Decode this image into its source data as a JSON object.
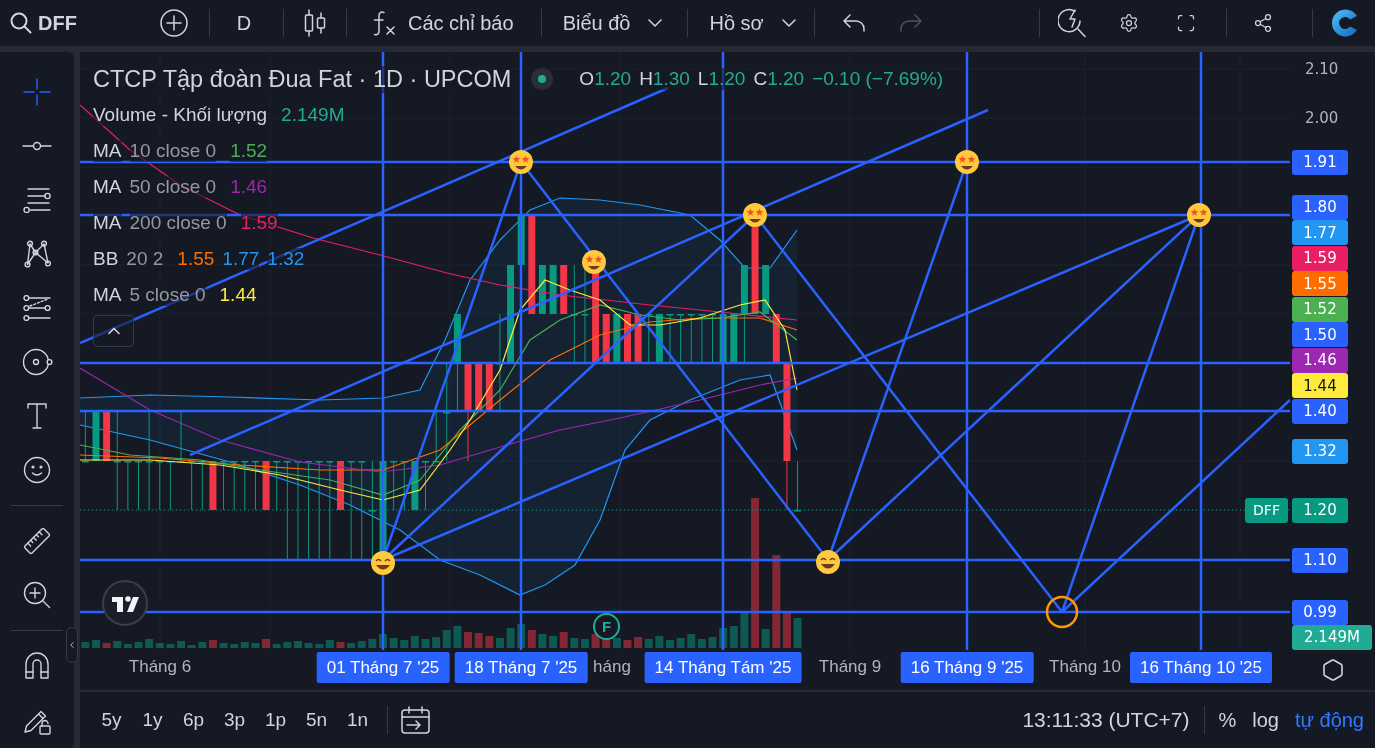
{
  "toolbar": {
    "symbol": "DFF",
    "interval": "D",
    "indicators": "Các chỉ báo",
    "menus": [
      {
        "label": "Biểu đồ"
      },
      {
        "label": "Hồ sơ"
      }
    ],
    "undo": {
      "disabled": false
    },
    "redo": {
      "disabled": true
    }
  },
  "sidebar": {
    "tools": [
      {
        "selected": true
      },
      {
        "selected": false
      },
      {
        "selected": false
      },
      {
        "selected": false
      },
      {
        "selected": false
      },
      {
        "selected": false
      },
      {
        "selected": false
      },
      {
        "selected": false
      },
      {
        "selected": false
      },
      {
        "selected": false
      },
      {
        "selected": false
      },
      {
        "selected": false
      }
    ]
  },
  "legend": {
    "title": "CTCP Tập đoàn Đua Fat · 1D · UPCOM",
    "ohlc": [
      {
        "label": "O",
        "value": "1.20"
      },
      {
        "label": "H",
        "value": "1.30"
      },
      {
        "label": "L",
        "value": "1.20"
      },
      {
        "label": "C",
        "value": "1.20"
      }
    ],
    "change": "−0.10 (−7.69%)",
    "indicators": [
      {
        "name": "Volume - Khối lượng",
        "values": [
          {
            "text": "2.149M",
            "color": "#22ab94"
          }
        ]
      },
      {
        "name": "MA",
        "params": "10 close 0",
        "values": [
          {
            "text": "1.52",
            "color": "#4caf50"
          }
        ]
      },
      {
        "name": "MA",
        "params": "50 close 0",
        "values": [
          {
            "text": "1.46",
            "color": "#9c27b0"
          }
        ]
      },
      {
        "name": "MA",
        "params": "200 close 0",
        "values": [
          {
            "text": "1.59",
            "color": "#e91e63"
          }
        ]
      },
      {
        "name": "BB",
        "params": "20 2",
        "values": [
          {
            "text": "1.55",
            "color": "#ff6d00"
          },
          {
            "text": "1.77",
            "color": "#2196f3"
          },
          {
            "text": "1.32",
            "color": "#2196f3"
          }
        ]
      },
      {
        "name": "MA",
        "params": "5 close 0",
        "values": [
          {
            "text": "1.44",
            "color": "#ffeb3b"
          }
        ]
      }
    ]
  },
  "chart": {
    "event_marker": "F"
  },
  "price_axis": {
    "labels": [
      {
        "kind": "tick",
        "text": "2.10"
      },
      {
        "kind": "tick",
        "text": "2.00"
      },
      {
        "kind": "line",
        "text": "1.91",
        "color": "#2962ff"
      },
      {
        "kind": "line",
        "text": "1.80",
        "color": "#2962ff"
      },
      {
        "kind": "line",
        "text": "1.77",
        "color": "#2196f3"
      },
      {
        "kind": "line",
        "text": "1.59",
        "color": "#e91e63"
      },
      {
        "kind": "line",
        "text": "1.55",
        "color": "#ff6d00"
      },
      {
        "kind": "line",
        "text": "1.52",
        "color": "#4caf50"
      },
      {
        "kind": "line",
        "text": "1.50",
        "color": "#2962ff"
      },
      {
        "kind": "line",
        "text": "1.46",
        "color": "#9c27b0"
      },
      {
        "kind": "line",
        "text": "1.44",
        "color": "#ffeb3b"
      },
      {
        "kind": "line",
        "text": "1.40",
        "color": "#2962ff"
      },
      {
        "kind": "line",
        "text": "1.32",
        "color": "#2196f3"
      },
      {
        "kind": "last",
        "symbol": "DFF",
        "text": "1.20",
        "color": "#089981"
      },
      {
        "kind": "line",
        "text": "1.10",
        "color": "#2962ff"
      },
      {
        "kind": "line",
        "text": "0.99",
        "color": "#2962ff"
      },
      {
        "kind": "volume",
        "text": "2.149M",
        "color": "#22ab94"
      }
    ]
  },
  "time_axis": {
    "labels": [
      {
        "text": "Tháng 6",
        "highlighted": false
      },
      {
        "text": "01 Tháng 7 '25",
        "highlighted": true
      },
      {
        "text": "18 Tháng 7 '25",
        "highlighted": true
      },
      {
        "text": "háng",
        "highlighted": false
      },
      {
        "text": "14 Tháng Tám '25",
        "highlighted": true
      },
      {
        "text": "Tháng 9",
        "highlighted": false
      },
      {
        "text": "16 Tháng 9 '25",
        "highlighted": true
      },
      {
        "text": "Tháng 10",
        "highlighted": false
      },
      {
        "text": "16 Tháng 10 '25",
        "highlighted": true
      }
    ]
  },
  "bottom_bar": {
    "ranges": [
      "5y",
      "1y",
      "6p",
      "3p",
      "1p",
      "5n",
      "1n"
    ],
    "time": "13:11:33 (UTC+7)",
    "scale_modes": [
      {
        "label": "%",
        "selected": false
      },
      {
        "label": "log",
        "selected": false
      },
      {
        "label": "tự động",
        "selected": true
      }
    ]
  }
}
